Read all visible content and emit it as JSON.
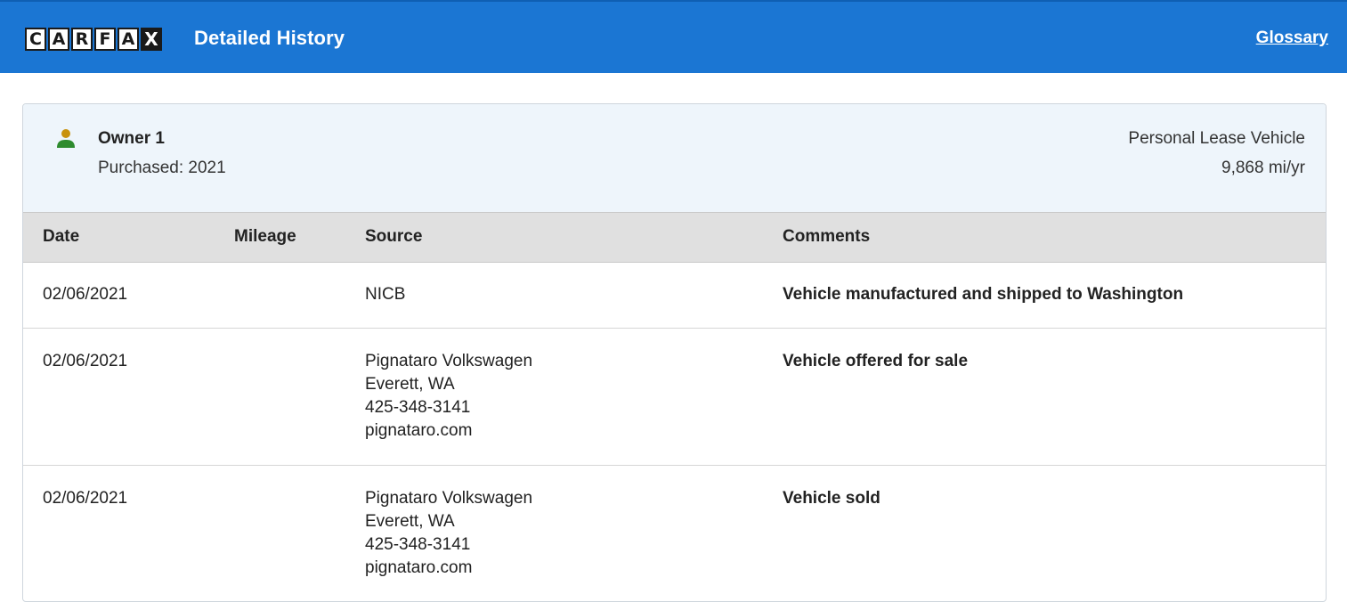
{
  "header": {
    "logo_letters": [
      "C",
      "A",
      "R",
      "F",
      "A",
      "X"
    ],
    "title": "Detailed History",
    "glossary_link": "Glossary",
    "color": "#1b76d3"
  },
  "owner": {
    "icon": "person-icon",
    "name": "Owner 1",
    "purchased": "Purchased: 2021",
    "type": "Personal Lease Vehicle",
    "miles_per_year": "9,868 mi/yr"
  },
  "table": {
    "headers": {
      "date": "Date",
      "mileage": "Mileage",
      "source": "Source",
      "comments": "Comments"
    },
    "rows": [
      {
        "date": "02/06/2021",
        "mileage": "",
        "source": [
          "NICB"
        ],
        "comment": "Vehicle manufactured and shipped to Washington"
      },
      {
        "date": "02/06/2021",
        "mileage": "",
        "source": [
          "Pignataro Volkswagen",
          "Everett, WA",
          "425-348-3141",
          "pignataro.com"
        ],
        "comment": "Vehicle offered for sale"
      },
      {
        "date": "02/06/2021",
        "mileage": "",
        "source": [
          "Pignataro Volkswagen",
          "Everett, WA",
          "425-348-3141",
          "pignataro.com"
        ],
        "comment": "Vehicle sold"
      }
    ]
  }
}
